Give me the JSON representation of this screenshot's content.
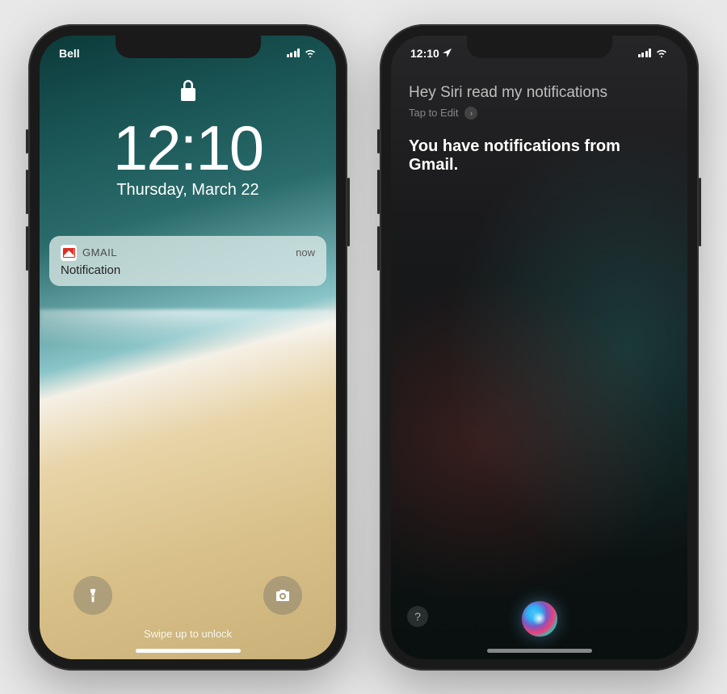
{
  "lock_screen": {
    "status": {
      "carrier": "Bell",
      "signal_icon": "signal-bars-icon",
      "wifi_icon": "wifi-icon"
    },
    "lock_icon": "lock-icon",
    "time": "12:10",
    "date": "Thursday, March 22",
    "notification": {
      "app_icon": "gmail-icon",
      "app_name": "GMAIL",
      "timestamp": "now",
      "body": "Notification"
    },
    "controls": {
      "flashlight_icon": "flashlight-icon",
      "camera_icon": "camera-icon"
    },
    "swipe_hint": "Swipe up to unlock"
  },
  "siri_screen": {
    "status": {
      "time": "12:10",
      "location_icon": "location-arrow-icon",
      "signal_icon": "signal-bars-icon",
      "wifi_icon": "wifi-icon"
    },
    "query": "Hey Siri read my notifications",
    "edit_hint": "Tap to Edit",
    "chevron_icon": "chevron-right-icon",
    "response": "You have notifications from Gmail.",
    "help_icon": "question-mark-icon",
    "siri_orb_icon": "siri-orb-icon"
  }
}
